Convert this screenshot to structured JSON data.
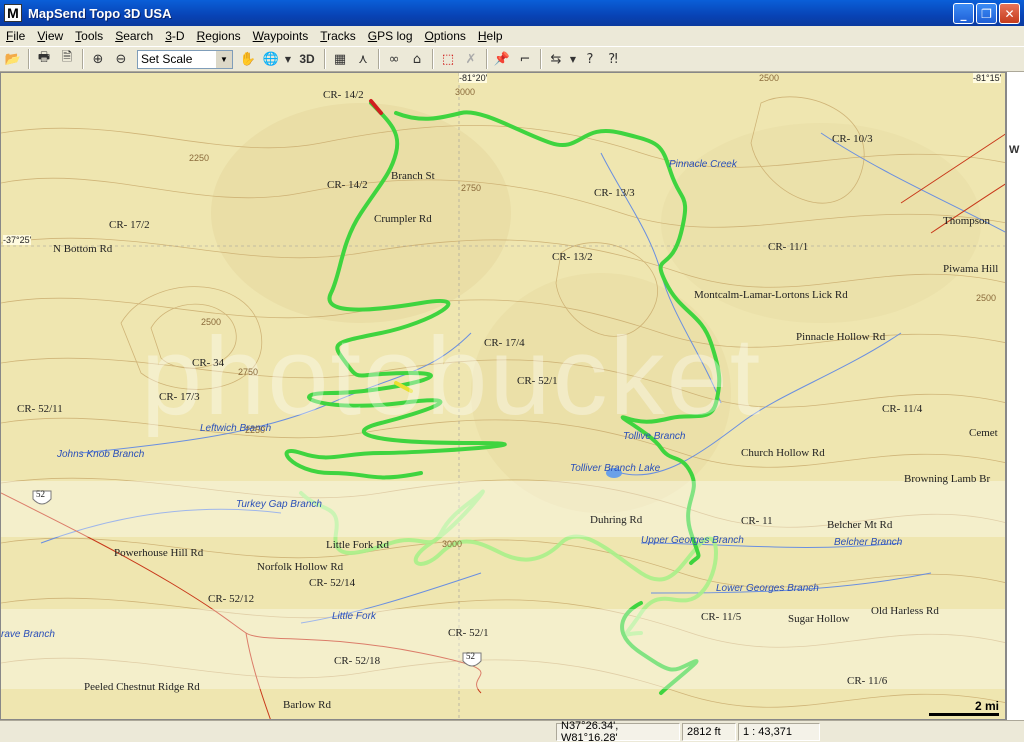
{
  "window": {
    "title": "MapSend Topo 3D USA",
    "icon_letter": "M",
    "minimize": "_",
    "maximize": "❐",
    "close": "✕"
  },
  "menu": [
    {
      "pre": "",
      "acc": "F",
      "post": "ile"
    },
    {
      "pre": "",
      "acc": "V",
      "post": "iew"
    },
    {
      "pre": "",
      "acc": "T",
      "post": "ools"
    },
    {
      "pre": "",
      "acc": "S",
      "post": "earch"
    },
    {
      "pre": "",
      "acc": "3",
      "post": "-D"
    },
    {
      "pre": "",
      "acc": "R",
      "post": "egions"
    },
    {
      "pre": "",
      "acc": "W",
      "post": "aypoints"
    },
    {
      "pre": "",
      "acc": "T",
      "post": "racks"
    },
    {
      "pre": "",
      "acc": "G",
      "post": "PS log"
    },
    {
      "pre": "",
      "acc": "O",
      "post": "ptions"
    },
    {
      "pre": "",
      "acc": "H",
      "post": "elp"
    }
  ],
  "toolbar": {
    "scale_select": "Set Scale",
    "three_d": "3D"
  },
  "map": {
    "roads": [
      {
        "text": "CR- 14/2"
      },
      {
        "text": "CR- 14/2"
      },
      {
        "text": "Branch St"
      },
      {
        "text": "Crumpler Rd"
      },
      {
        "text": "CR- 17/2"
      },
      {
        "text": "N Bottom Rd"
      },
      {
        "text": "CR- 34"
      },
      {
        "text": "CR- 17/3"
      },
      {
        "text": "CR- 52/11"
      },
      {
        "text": "CR- 13/3"
      },
      {
        "text": "CR- 13/2"
      },
      {
        "text": "CR- 10/3"
      },
      {
        "text": "CR- 11/1"
      },
      {
        "text": "Thompson"
      },
      {
        "text": "Piwama Hill"
      },
      {
        "text": "Montcalm-Lamar-Lortons Lick Rd"
      },
      {
        "text": "Pinnacle Hollow Rd"
      },
      {
        "text": "CR- 17/4"
      },
      {
        "text": "CR- 52/1"
      },
      {
        "text": "CR- 11/4"
      },
      {
        "text": "Cemet"
      },
      {
        "text": "Church Hollow Rd"
      },
      {
        "text": "Browning Lamb Br"
      },
      {
        "text": "Duhring Rd"
      },
      {
        "text": "CR- 11"
      },
      {
        "text": "Belcher Mt Rd"
      },
      {
        "text": "Powerhouse Hill Rd"
      },
      {
        "text": "Little Fork Rd"
      },
      {
        "text": "Norfolk Hollow Rd"
      },
      {
        "text": "CR- 52/14"
      },
      {
        "text": "CR- 52/12"
      },
      {
        "text": "CR- 52/1"
      },
      {
        "text": "CR- 52/18"
      },
      {
        "text": "CR- 11/5"
      },
      {
        "text": "Sugar Hollow"
      },
      {
        "text": "Old Harless Rd"
      },
      {
        "text": "Peeled Chestnut Ridge Rd"
      },
      {
        "text": "Barlow Rd"
      },
      {
        "text": "CR- 11/6"
      }
    ],
    "water": [
      {
        "text": "Pinnacle Creek"
      },
      {
        "text": "Leftwich Branch"
      },
      {
        "text": "Johns Knob Branch"
      },
      {
        "text": "Tollive Branch"
      },
      {
        "text": "Tolliver Branch Lake"
      },
      {
        "text": "Turkey Gap Branch"
      },
      {
        "text": "Upper Georges Branch"
      },
      {
        "text": "Belcher Branch"
      },
      {
        "text": "Lower Georges Branch"
      },
      {
        "text": "Little Fork"
      },
      {
        "text": "rave Branch"
      }
    ],
    "coords": [
      {
        "text": "-81°20'"
      },
      {
        "text": "-81°15'"
      },
      {
        "text": "-37°25'"
      }
    ],
    "elevations": [
      {
        "text": "3000"
      },
      {
        "text": "2500"
      },
      {
        "text": "2250"
      },
      {
        "text": "2500"
      },
      {
        "text": "2750"
      },
      {
        "text": "2750"
      },
      {
        "text": "2500"
      },
      {
        "text": "3000"
      },
      {
        "text": "2250"
      }
    ],
    "shields": [
      {
        "text": "52"
      },
      {
        "text": "52"
      }
    ],
    "watermark": "photobucket",
    "scale_label": "2 mi"
  },
  "side": {
    "mark": "W"
  },
  "status": {
    "coords": "N37°26.34', W81°16.28'",
    "elevation": "2812 ft",
    "scale": "1 : 43,371"
  },
  "colors": {
    "track": "#3fd43f",
    "track_light": "#a8f08a",
    "map_bg": "#efe6b0",
    "contour": "#c8a86a"
  }
}
